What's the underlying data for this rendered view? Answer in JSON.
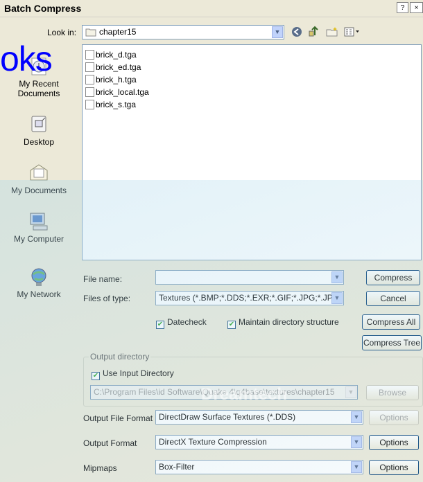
{
  "window": {
    "title": "Batch Compress",
    "help_btn": "?",
    "close_btn": "×"
  },
  "lookin": {
    "label": "Look in:",
    "value": "chapter15"
  },
  "toolbar_icons": [
    "back-icon",
    "up-folder-icon",
    "new-folder-icon",
    "view-menu-icon"
  ],
  "places": [
    {
      "name": "My Recent Documents",
      "line1": "My Recent",
      "line2": "Documents",
      "icon": "recent-documents-icon"
    },
    {
      "name": "Desktop",
      "line1": "Desktop",
      "icon": "desktop-icon"
    },
    {
      "name": "My Documents",
      "line1": "My Documents",
      "icon": "my-documents-icon"
    },
    {
      "name": "My Computer",
      "line1": "My Computer",
      "icon": "my-computer-icon"
    },
    {
      "name": "My Network",
      "line1": "My Network",
      "icon": "my-network-icon"
    }
  ],
  "files": [
    "brick_d.tga",
    "brick_ed.tga",
    "brick_h.tga",
    "brick_local.tga",
    "brick_s.tga"
  ],
  "filename": {
    "label": "File name:",
    "value": ""
  },
  "filetype": {
    "label": "Files of type:",
    "value": "Textures (*.BMP;*.DDS;*.EXR;*.GIF;*.JPG;*.JP"
  },
  "buttons": {
    "compress": "Compress",
    "cancel": "Cancel",
    "compress_all": "Compress All",
    "compress_tree": "Compress Tree"
  },
  "checks": {
    "datecheck": "Datecheck",
    "maintain": "Maintain directory structure",
    "use_input": "Use Input Directory"
  },
  "output_dir": {
    "legend": "Output directory",
    "path": "C:\\Program Files\\id Software\\Quake 4\\q4base\\textures\\chapter15",
    "browse": "Browse"
  },
  "output_file_format": {
    "label": "Output File Format",
    "value": "DirectDraw Surface Textures (*.DDS)",
    "options": "Options"
  },
  "output_format": {
    "label": "Output  Format",
    "value": "DirectX Texture Compression",
    "options": "Options"
  },
  "mipmaps": {
    "label": "Mipmaps",
    "value": "Box-Filter",
    "options": "Options"
  },
  "overlay": {
    "brand_text": "oks",
    "watermark_text": "Dreamtech"
  }
}
